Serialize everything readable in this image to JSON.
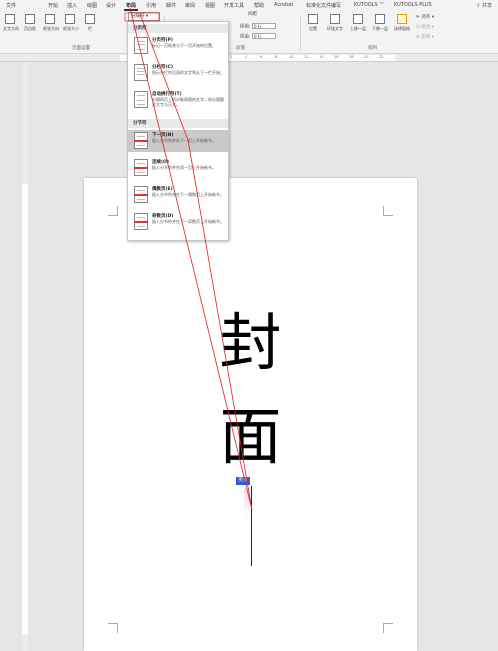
{
  "tabs": [
    "文件",
    "开始",
    "插入",
    "绘图",
    "设计",
    "布局",
    "引用",
    "邮件",
    "审阅",
    "视图",
    "开发工具",
    "帮助",
    "Acrobat",
    "标准化文件编写",
    "KUTOOLS ™",
    "KUTOOLS PLUS"
  ],
  "active_tab_index": 5,
  "share_label": "共享",
  "ribbon": {
    "page_setup_buttons": [
      "文字方向",
      "页边距",
      "纸张方向",
      "纸张大小",
      "栏"
    ],
    "breaks_label": "分隔符",
    "page_setup_group": "页面设置",
    "paragraph_group": "段落",
    "arrange_group": "排列",
    "spacing_title": "间距",
    "before_label": "段前:",
    "after_label": "段后:",
    "before_value": "0 行",
    "after_value": "0 行",
    "arrange_buttons": [
      "位置",
      "环绕文字",
      "上移一层",
      "下移一层",
      "选择窗格"
    ],
    "align_label": "对齐",
    "combine_label": "组合",
    "rotate_label": "旋转"
  },
  "ruler_numbers": [
    "2",
    "4",
    "6",
    "8",
    "10",
    "12",
    "14",
    "16",
    "18",
    "20",
    "22",
    "24",
    "26",
    "28",
    "30",
    "32",
    "34",
    "36",
    "38"
  ],
  "breaks_menu": {
    "page_breaks_header": "分页符",
    "section_breaks_header": "分节符",
    "items": [
      {
        "title": "分页符(P)",
        "desc": "标记一页结束与下一页开始的位置。"
      },
      {
        "title": "分栏符(C)",
        "desc": "指示分栏符后面的文字将从下一栏开始。"
      },
      {
        "title": "自动换行符(T)",
        "desc": "分隔网页上的对象周围的文字，如分隔题注文字与正文。"
      },
      {
        "title": "下一页(N)",
        "desc": "插入分节符并在下一页上开始新节。"
      },
      {
        "title": "连续(O)",
        "desc": "插入分节符并在同一页上开始新节。"
      },
      {
        "title": "偶数页(E)",
        "desc": "插入分节符并在下一偶数页上开始新节。"
      },
      {
        "title": "奇数页(D)",
        "desc": "插入分节符并在下一奇数页上开始新节。"
      }
    ],
    "selected_index": 3
  },
  "document": {
    "cover_char_1": "封",
    "cover_char_2": "面",
    "lang_tag": "英文"
  },
  "colors": {
    "annotation_red": "#e02020",
    "lang_tag_blue": "#2f5ed6",
    "selected_item": "#c9c9c9"
  }
}
